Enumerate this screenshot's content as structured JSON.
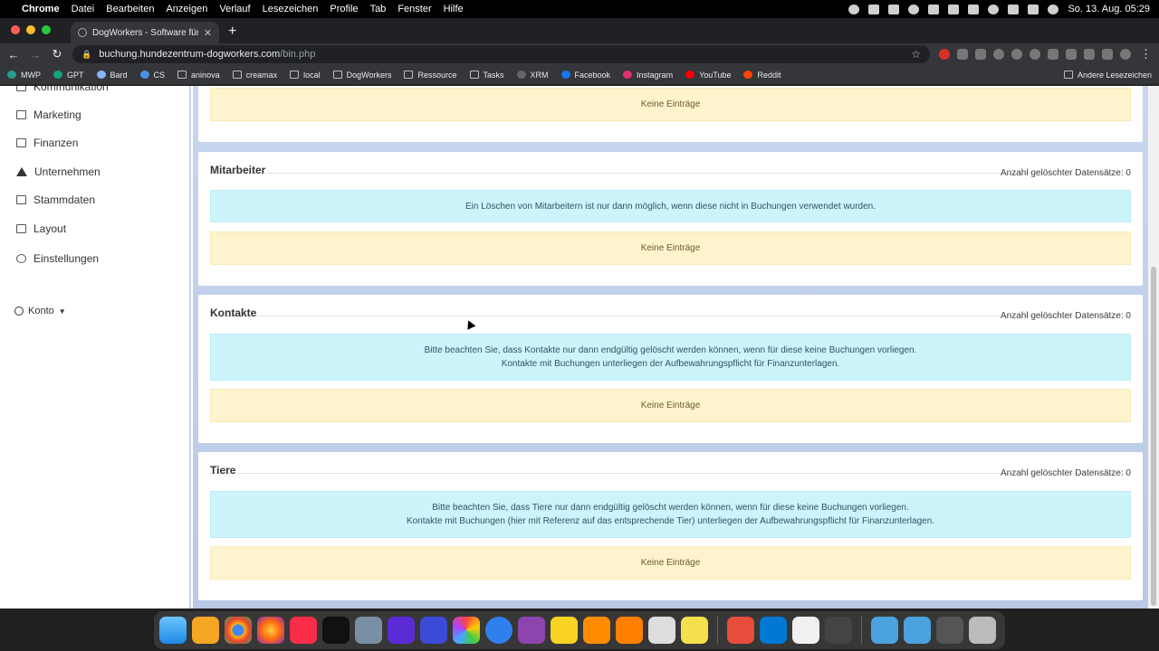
{
  "menubar": {
    "app": "Chrome",
    "items": [
      "Datei",
      "Bearbeiten",
      "Anzeigen",
      "Verlauf",
      "Lesezeichen",
      "Profile",
      "Tab",
      "Fenster",
      "Hilfe"
    ],
    "clock": "So. 13. Aug. 05:29"
  },
  "browser": {
    "tab_title": "DogWorkers - Software für die",
    "url_host": "buchung.hundezentrum-dogworkers.com",
    "url_path": "/bin.php"
  },
  "bookmarks": {
    "items": [
      "MWP",
      "GPT",
      "Bard",
      "CS",
      "aninova",
      "creamax",
      "local",
      "DogWorkers",
      "Ressource",
      "Tasks",
      "XRM",
      "Facebook",
      "Instagram",
      "YouTube",
      "Reddit"
    ],
    "other": "Andere Lesezeichen"
  },
  "sidebar": {
    "cut_item": "Kommunikation",
    "items": [
      {
        "label": "Marketing",
        "icon": "mail-icon"
      },
      {
        "label": "Finanzen",
        "icon": "cash-icon"
      },
      {
        "label": "Unternehmen",
        "icon": "house-icon"
      },
      {
        "label": "Stammdaten",
        "icon": "database-icon"
      },
      {
        "label": "Layout",
        "icon": "layout-icon"
      },
      {
        "label": "Einstellungen",
        "icon": "gear-icon"
      }
    ],
    "account": "Konto"
  },
  "main": {
    "top_card": {
      "empty": "Keine Einträge"
    },
    "sections": [
      {
        "title": "Mitarbeiter",
        "count": "Anzahl gelöschter Datensätze: 0",
        "info": [
          "Ein Löschen von Mitarbeitern ist nur dann möglich, wenn diese nicht in Buchungen verwendet wurden."
        ],
        "empty": "Keine Einträge"
      },
      {
        "title": "Kontakte",
        "count": "Anzahl gelöschter Datensätze: 0",
        "info": [
          "Bitte beachten Sie, dass Kontakte nur dann endgültig gelöscht werden können, wenn für diese keine Buchungen vorliegen.",
          "Kontakte mit Buchungen unterliegen der Aufbewahrungspflicht für Finanzunterlagen."
        ],
        "empty": "Keine Einträge"
      },
      {
        "title": "Tiere",
        "count": "Anzahl gelöschter Datensätze: 0",
        "info": [
          "Bitte beachten Sie, dass Tiere nur dann endgültig gelöscht werden können, wenn für diese keine Buchungen vorliegen.",
          "Kontakte mit Buchungen (hier mit Referenz auf das entsprechende Tier) unterliegen der Aufbewahrungspflicht für Finanzunterlagen."
        ],
        "empty": "Keine Einträge"
      }
    ]
  },
  "colors": {
    "info_bg": "#cdf3fb",
    "empty_bg": "#fdf3cd",
    "content_bg": "#c9d6ee"
  }
}
